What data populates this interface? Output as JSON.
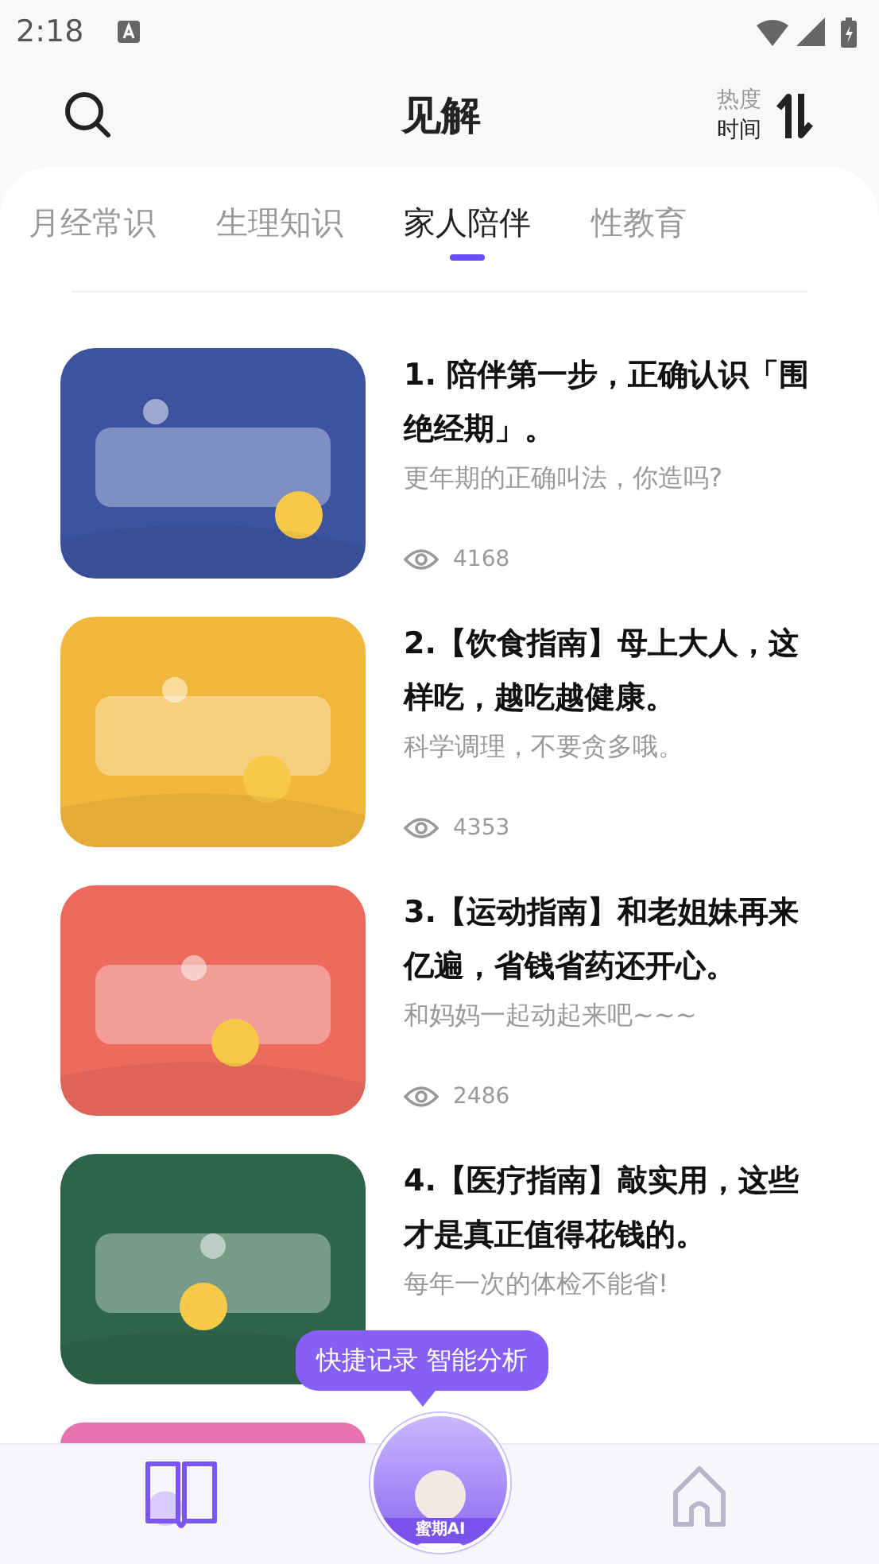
{
  "status_bar": {
    "time": "2:18"
  },
  "header": {
    "title": "见解",
    "sort_options": [
      {
        "label": "热度",
        "selected": false
      },
      {
        "label": "时间",
        "selected": true
      }
    ]
  },
  "tabs": [
    {
      "label": "月经常识",
      "selected": false
    },
    {
      "label": "生理知识",
      "selected": false
    },
    {
      "label": "家人陪伴",
      "selected": true
    },
    {
      "label": "性教育",
      "selected": false
    }
  ],
  "articles": [
    {
      "title": "1. 陪伴第一步，正确认识「围绝经期」。",
      "subtitle": "更年期的正确叫法，你造吗?",
      "views": "4168",
      "color": "#3c53a0",
      "kind": "picture"
    },
    {
      "title": "2.【饮食指南】母上大人，这样吃，越吃越健康。",
      "subtitle": "科学调理，不要贪多哦。",
      "views": "4353",
      "color": "#f2b73d",
      "kind": "picture"
    },
    {
      "title": "3.【运动指南】和老姐妹再来亿遍，省钱省药还开心。",
      "subtitle": "和妈妈一起动起来吧~~~",
      "views": "2486",
      "color": "#ec6b5e",
      "kind": "picture"
    },
    {
      "title": "4.【医疗指南】敲实用，这些才是真正值得花钱的。",
      "subtitle": "每年一次的体检不能省!",
      "color": "#2f644c",
      "kind": "picture"
    },
    {
      "color": "#e774b0",
      "kind": "picture"
    }
  ],
  "tooltip": "快捷记录 智能分析",
  "assistant": {
    "label": "蜜期AI"
  },
  "bottom_nav": [
    {
      "kind": "book",
      "selected": true
    },
    {
      "kind": "home",
      "selected": false
    }
  ]
}
